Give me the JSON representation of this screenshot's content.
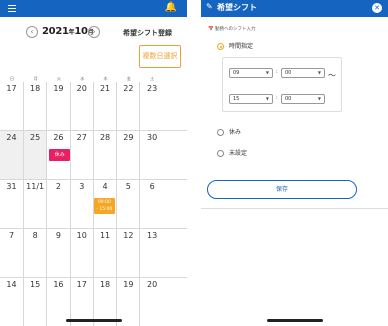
{
  "left": {
    "year_month_prefix": "2021",
    "year_suffix": "年",
    "month": "10",
    "month_suffix": "月",
    "register_title": "希望シフト登録",
    "multi_select_label": "複数日選択",
    "weekdays": [
      "日",
      "月",
      "火",
      "水",
      "木",
      "金",
      "土"
    ],
    "weeks": [
      [
        "17",
        "18",
        "19",
        "20",
        "21",
        "22",
        "23"
      ],
      [
        "24",
        "25",
        "26",
        "27",
        "28",
        "29",
        "30"
      ],
      [
        "31",
        "11/1",
        "2",
        "3",
        "4",
        "5",
        "6"
      ],
      [
        "7",
        "8",
        "9",
        "10",
        "11",
        "12",
        "13"
      ],
      [
        "14",
        "15",
        "16",
        "17",
        "18",
        "19",
        "20"
      ]
    ],
    "off_badge": "休み",
    "time_badge_line1": "09:00",
    "time_badge_line2": "- 15:00"
  },
  "right": {
    "title": "希望シフト",
    "subheading": "勤務へのシフト入力",
    "option_time": "時間指定",
    "option_off": "休み",
    "option_unset": "未設定",
    "start_hour": "09",
    "start_min": "00",
    "end_hour": "15",
    "end_min": "00",
    "tilde": "〜",
    "save_label": "保存"
  },
  "colors": {
    "header_blue": "#1565c0",
    "orange": "#f5a623",
    "pink": "#e91e63"
  }
}
